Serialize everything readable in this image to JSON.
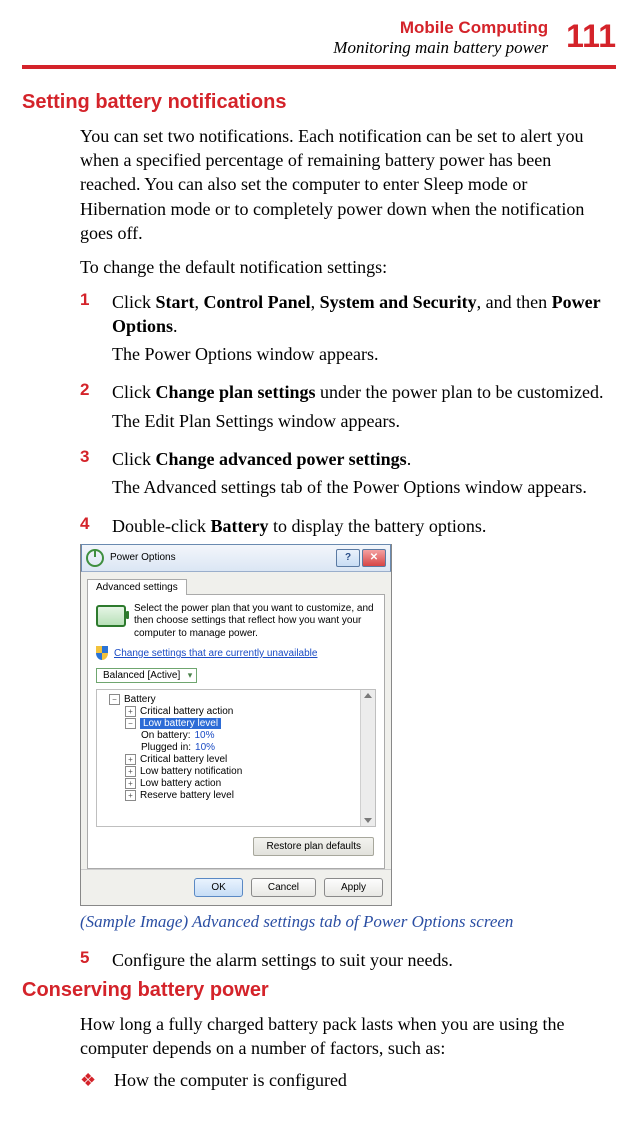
{
  "header": {
    "chapter": "Mobile Computing",
    "section": "Monitoring main battery power",
    "page_number": "111"
  },
  "h1": "Setting battery notifications",
  "intro": "You can set two notifications. Each notification can be set to alert you when a specified percentage of remaining battery power has been reached. You can also set the computer to enter Sleep mode or Hibernation mode or to completely power down when the notification goes off.",
  "lead": "To change the default notification settings:",
  "steps": {
    "s1": {
      "num": "1",
      "pre": "Click ",
      "b1": "Start",
      "sep1": ", ",
      "b2": "Control Panel",
      "sep2": ", ",
      "b3": "System and Security",
      "sep3": ", and then ",
      "b4": "Power Options",
      "post": ".",
      "sub": "The Power Options window appears."
    },
    "s2": {
      "num": "2",
      "pre": "Click ",
      "b1": "Change plan settings",
      "post": " under the power plan to be customized.",
      "sub": "The Edit Plan Settings window appears."
    },
    "s3": {
      "num": "3",
      "pre": "Click ",
      "b1": "Change advanced power settings",
      "post": ".",
      "sub": "The Advanced settings tab of the Power Options window appears."
    },
    "s4": {
      "num": "4",
      "pre": "Double-click ",
      "b1": "Battery",
      "post": " to display the battery options."
    },
    "s5": {
      "num": "5",
      "text": "Configure the alarm settings to suit your needs."
    }
  },
  "caption": "(Sample Image) Advanced settings tab of Power Options screen",
  "h2": "Conserving battery power",
  "p2": "How long a fully charged battery pack lasts when you are using the computer depends on a number of factors, such as:",
  "bullet1": "How the computer is configured",
  "dialog": {
    "title": "Power Options",
    "help_glyph": "?",
    "close_glyph": "✕",
    "tab": "Advanced settings",
    "desc": "Select the power plan that you want to customize, and then choose settings that reflect how you want your computer to manage power.",
    "link": "Change settings that are currently unavailable",
    "plan": "Balanced [Active]",
    "tree": {
      "root": "Battery",
      "n1": "Critical battery action",
      "n2": "Low battery level",
      "n2a_label": "On battery:",
      "n2a_val": "10%",
      "n2b_label": "Plugged in:",
      "n2b_val": "10%",
      "n3": "Critical battery level",
      "n4": "Low battery notification",
      "n5": "Low battery action",
      "n6": "Reserve battery level"
    },
    "restore": "Restore plan defaults",
    "ok": "OK",
    "cancel": "Cancel",
    "apply": "Apply"
  }
}
